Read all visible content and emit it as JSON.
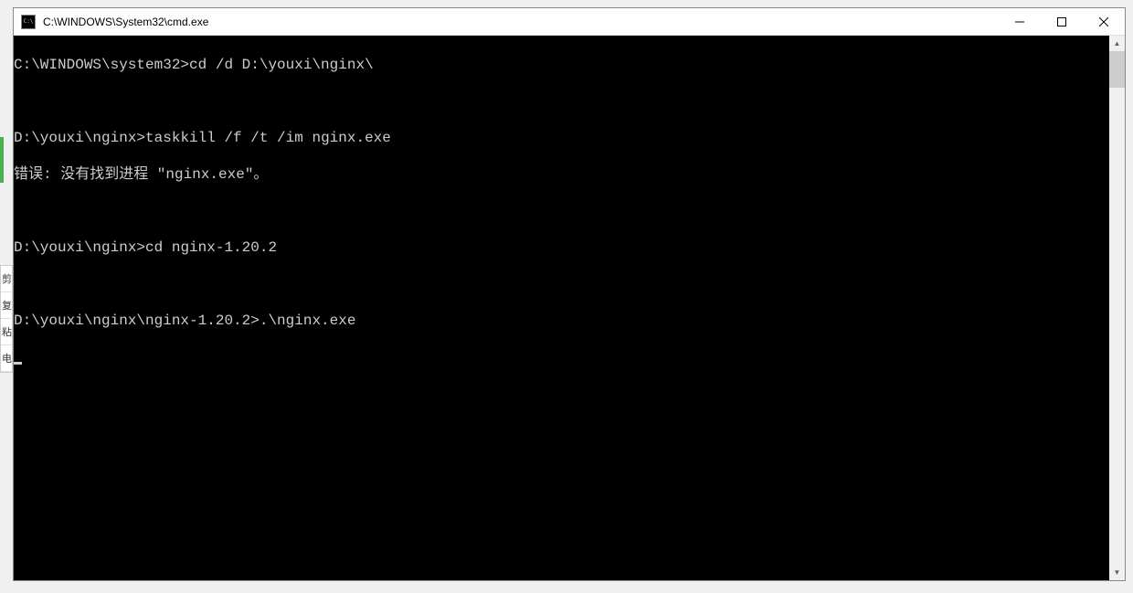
{
  "window": {
    "title": "C:\\WINDOWS\\System32\\cmd.exe"
  },
  "side_toolbar": {
    "item1": "剪",
    "item2": "复",
    "item3": "粘",
    "item4": "电"
  },
  "terminal": {
    "lines": [
      {
        "prompt": "C:\\WINDOWS\\system32>",
        "cmd": "cd /d D:\\youxi\\nginx\\"
      },
      {
        "text": ""
      },
      {
        "prompt": "D:\\youxi\\nginx>",
        "cmd": "taskkill /f /t /im nginx.exe"
      },
      {
        "text": "错误: 没有找到进程 \"nginx.exe\"。"
      },
      {
        "text": ""
      },
      {
        "prompt": "D:\\youxi\\nginx>",
        "cmd": "cd nginx-1.20.2"
      },
      {
        "text": ""
      },
      {
        "prompt": "D:\\youxi\\nginx\\nginx-1.20.2>",
        "cmd": ".\\nginx.exe"
      }
    ]
  }
}
